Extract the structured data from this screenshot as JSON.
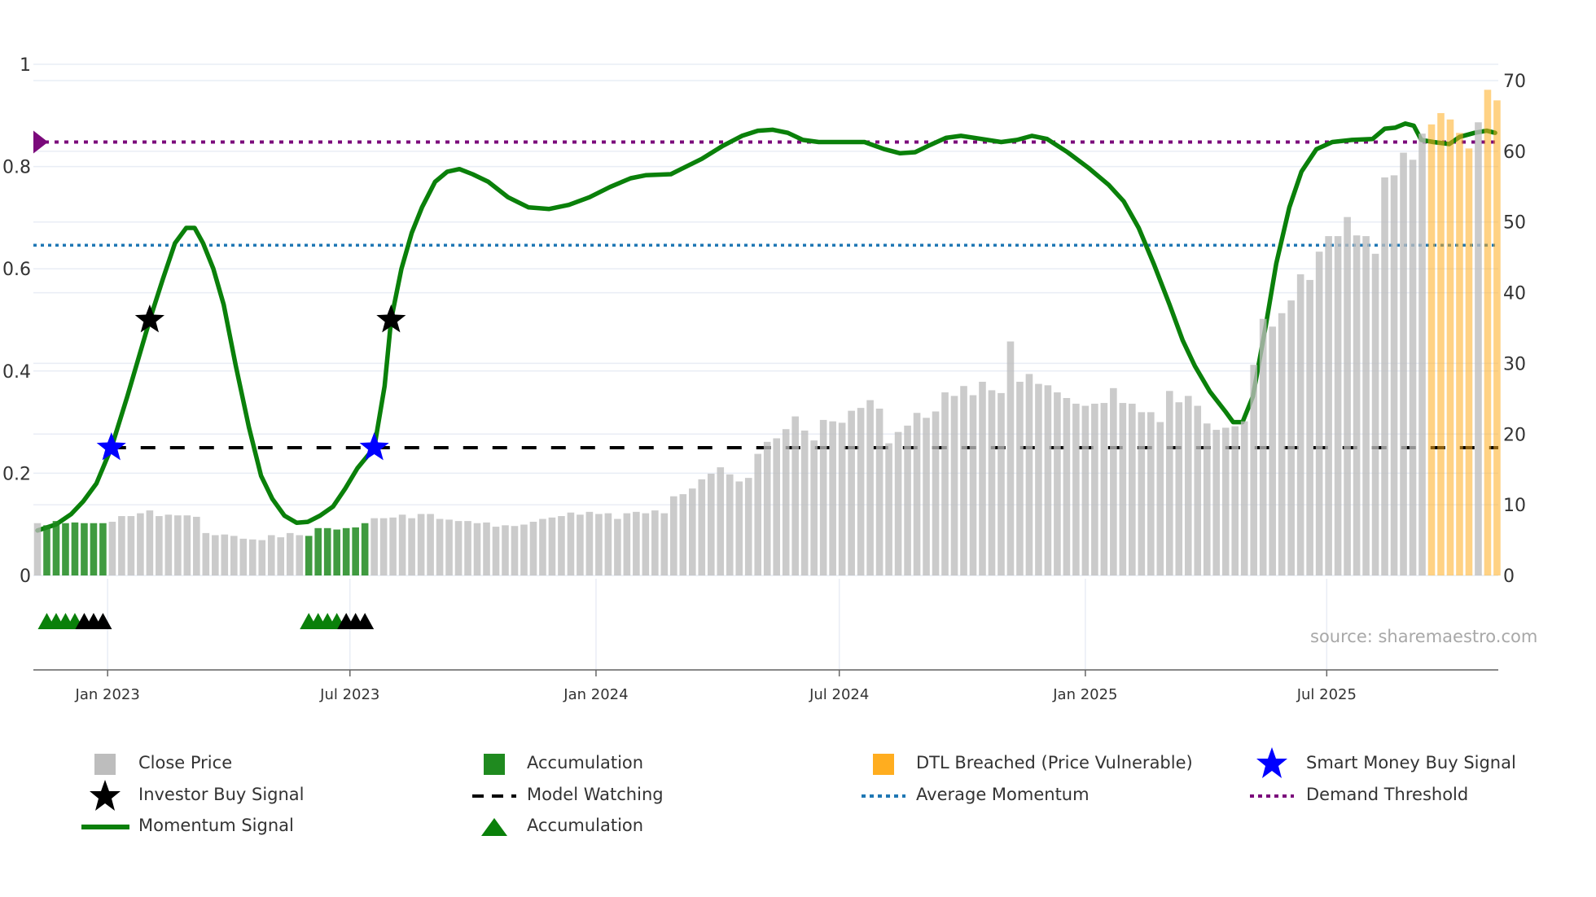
{
  "chart_data": {
    "type": "bar",
    "title": "",
    "x_ticks": [
      "Jan 2023",
      "Jul 2023",
      "Jan 2024",
      "Jul 2024",
      "Jan 2025",
      "Jul 2025"
    ],
    "x_tick_weeks": [
      8.5,
      34.4,
      60.7,
      86.7,
      113.0,
      138.8
    ],
    "left_axis": {
      "ticks": [
        "0",
        "0.2",
        "0.4",
        "0.6",
        "0.8",
        "1"
      ],
      "values": [
        0,
        0.2,
        0.4,
        0.6,
        0.8,
        1
      ],
      "range": [
        0,
        1
      ]
    },
    "right_axis": {
      "ticks": [
        "0",
        "10",
        "20",
        "30",
        "40",
        "50",
        "60",
        "70"
      ],
      "values": [
        0,
        10,
        20,
        30,
        40,
        50,
        60,
        70
      ],
      "range": [
        0,
        70
      ]
    },
    "close_price": [
      7.4,
      7.1,
      7.7,
      7.4,
      7.5,
      7.4,
      7.4,
      7.4,
      7.6,
      8.4,
      8.4,
      8.8,
      9.2,
      8.4,
      8.6,
      8.5,
      8.5,
      8.3,
      6.0,
      5.7,
      5.8,
      5.6,
      5.2,
      5.1,
      5.0,
      5.7,
      5.4,
      6.0,
      5.7,
      5.6,
      6.7,
      6.7,
      6.5,
      6.7,
      6.8,
      7.4,
      8.1,
      8.1,
      8.2,
      8.6,
      8.1,
      8.7,
      8.7,
      8.0,
      7.9,
      7.7,
      7.7,
      7.4,
      7.5,
      6.9,
      7.1,
      7.0,
      7.2,
      7.6,
      8.0,
      8.2,
      8.4,
      8.9,
      8.6,
      9.0,
      8.7,
      8.8,
      8.0,
      8.8,
      9.0,
      8.8,
      9.2,
      8.8,
      11.2,
      11.5,
      12.3,
      13.6,
      14.4,
      15.3,
      14.3,
      13.3,
      13.8,
      17.2,
      18.9,
      19.4,
      20.7,
      22.5,
      20.5,
      19.1,
      22.0,
      21.8,
      21.6,
      23.3,
      23.7,
      24.8,
      23.6,
      18.7,
      20.3,
      21.2,
      23.0,
      22.3,
      23.2,
      25.9,
      25.4,
      26.8,
      25.5,
      27.4,
      26.2,
      25.8,
      33.1,
      27.4,
      28.5,
      27.1,
      26.9,
      25.9,
      25.1,
      24.3,
      24.0,
      24.3,
      24.4,
      26.5,
      24.4,
      24.3,
      23.1,
      23.1,
      21.7,
      26.1,
      24.5,
      25.4,
      24.0,
      21.5,
      20.6,
      20.9,
      21.1,
      21.8,
      29.8,
      36.3,
      35.2,
      37.1,
      38.9,
      42.6,
      41.8,
      45.8,
      48.0,
      48.0,
      50.7,
      48.1,
      48.0,
      45.5,
      56.3,
      56.6,
      59.8,
      58.8,
      62.5,
      63.8,
      65.4,
      64.5,
      62.6,
      60.4,
      64.1,
      68.7,
      67.2
    ],
    "accumulation_bars": [
      2,
      3,
      4,
      5,
      6,
      7,
      8,
      30,
      31,
      32,
      33,
      34,
      35,
      36
    ],
    "dtl_breached_bars": [
      150,
      151,
      152,
      153,
      154,
      156,
      157
    ],
    "momentum_signal": [
      [
        1.0,
        0.088
      ],
      [
        3.0,
        0.1
      ],
      [
        4.6,
        0.12
      ],
      [
        5.9,
        0.145
      ],
      [
        7.3,
        0.18
      ],
      [
        8.9,
        0.25
      ],
      [
        10.6,
        0.35
      ],
      [
        12.2,
        0.45
      ],
      [
        13.0,
        0.5
      ],
      [
        14.4,
        0.58
      ],
      [
        15.7,
        0.65
      ],
      [
        16.9,
        0.68
      ],
      [
        17.8,
        0.68
      ],
      [
        18.7,
        0.65
      ],
      [
        19.8,
        0.6
      ],
      [
        20.9,
        0.53
      ],
      [
        22.2,
        0.41
      ],
      [
        23.6,
        0.29
      ],
      [
        24.9,
        0.195
      ],
      [
        26.1,
        0.15
      ],
      [
        27.4,
        0.117
      ],
      [
        28.7,
        0.103
      ],
      [
        29.9,
        0.105
      ],
      [
        31.2,
        0.117
      ],
      [
        32.6,
        0.135
      ],
      [
        33.9,
        0.17
      ],
      [
        35.2,
        0.21
      ],
      [
        37.0,
        0.25
      ],
      [
        38.1,
        0.37
      ],
      [
        38.8,
        0.5
      ],
      [
        39.9,
        0.6
      ],
      [
        41.0,
        0.67
      ],
      [
        42.1,
        0.72
      ],
      [
        43.5,
        0.77
      ],
      [
        44.8,
        0.79
      ],
      [
        46.1,
        0.795
      ],
      [
        47.5,
        0.785
      ],
      [
        49.2,
        0.77
      ],
      [
        51.3,
        0.74
      ],
      [
        53.5,
        0.72
      ],
      [
        55.7,
        0.717
      ],
      [
        57.8,
        0.725
      ],
      [
        60.0,
        0.74
      ],
      [
        62.2,
        0.76
      ],
      [
        64.4,
        0.777
      ],
      [
        66.0,
        0.783
      ],
      [
        68.7,
        0.785
      ],
      [
        69.8,
        0.795
      ],
      [
        72.0,
        0.815
      ],
      [
        74.2,
        0.84
      ],
      [
        76.3,
        0.86
      ],
      [
        78.0,
        0.87
      ],
      [
        79.6,
        0.872
      ],
      [
        81.2,
        0.866
      ],
      [
        82.8,
        0.852
      ],
      [
        84.5,
        0.848
      ],
      [
        87.2,
        0.848
      ],
      [
        89.4,
        0.848
      ],
      [
        91.5,
        0.834
      ],
      [
        93.2,
        0.826
      ],
      [
        94.8,
        0.828
      ],
      [
        96.4,
        0.842
      ],
      [
        98.1,
        0.856
      ],
      [
        99.7,
        0.86
      ],
      [
        101.9,
        0.854
      ],
      [
        104.0,
        0.848
      ],
      [
        105.7,
        0.852
      ],
      [
        107.3,
        0.86
      ],
      [
        108.9,
        0.854
      ],
      [
        111.1,
        0.828
      ],
      [
        113.3,
        0.798
      ],
      [
        115.5,
        0.764
      ],
      [
        117.1,
        0.732
      ],
      [
        118.7,
        0.68
      ],
      [
        120.3,
        0.61
      ],
      [
        122.0,
        0.53
      ],
      [
        123.4,
        0.46
      ],
      [
        124.7,
        0.41
      ],
      [
        126.3,
        0.36
      ],
      [
        128.0,
        0.32
      ],
      [
        128.8,
        0.3
      ],
      [
        129.8,
        0.3
      ],
      [
        130.9,
        0.35
      ],
      [
        132.3,
        0.49
      ],
      [
        133.4,
        0.61
      ],
      [
        134.8,
        0.72
      ],
      [
        136.1,
        0.79
      ],
      [
        137.7,
        0.834
      ],
      [
        139.4,
        0.848
      ],
      [
        141.5,
        0.852
      ],
      [
        143.7,
        0.854
      ],
      [
        145.0,
        0.874
      ],
      [
        146.1,
        0.876
      ],
      [
        147.2,
        0.884
      ],
      [
        148.1,
        0.88
      ],
      [
        148.9,
        0.852
      ],
      [
        150.2,
        0.848
      ],
      [
        151.9,
        0.844
      ],
      [
        153.0,
        0.858
      ],
      [
        154.6,
        0.866
      ],
      [
        155.9,
        0.87
      ],
      [
        156.8,
        0.866
      ]
    ],
    "investor_buy_signals": [
      [
        13.0,
        0.5
      ],
      [
        38.8,
        0.5
      ]
    ],
    "smart_money_buy_signals": [
      [
        8.9,
        0.25
      ],
      [
        37.0,
        0.25
      ]
    ],
    "model_watching": {
      "value": 0.25,
      "from_week": 8.9
    },
    "average_momentum": 0.646,
    "demand_threshold": 0.848,
    "accumulation_triangles_green": [
      2,
      3,
      4,
      5,
      30,
      31,
      32,
      33
    ],
    "accumulation_triangles_black": [
      6,
      7,
      8,
      34,
      35,
      36
    ],
    "legend": [
      {
        "label": "Close Price",
        "icon": "gray-square"
      },
      {
        "label": "Accumulation",
        "icon": "green-square"
      },
      {
        "label": "DTL Breached (Price Vulnerable)",
        "icon": "orange-square"
      },
      {
        "label": "Smart Money Buy Signal",
        "icon": "blue-star"
      },
      {
        "label": "Investor Buy Signal",
        "icon": "black-star"
      },
      {
        "label": "Model Watching",
        "icon": "black-dashed-line"
      },
      {
        "label": "Average Momentum",
        "icon": "blue-dotted-line"
      },
      {
        "label": "Demand Threshold",
        "icon": "purple-dotted-line"
      },
      {
        "label": "Momentum Signal",
        "icon": "green-line"
      },
      {
        "label": "Accumulation",
        "icon": "green-triangle"
      }
    ],
    "legend_placement": "bottom",
    "grid": true,
    "source": "source: sharemaestro.com"
  },
  "colors": {
    "close": "#bdbdbd",
    "accumulation": "#1f8a1f",
    "dtl": "#ffad1f",
    "momentum": "#0a800a",
    "avg": "#1f77b4",
    "demand": "#7b0a7b",
    "blue_star": "#0000ff",
    "black": "#000000",
    "grid": "#e9edf5"
  }
}
